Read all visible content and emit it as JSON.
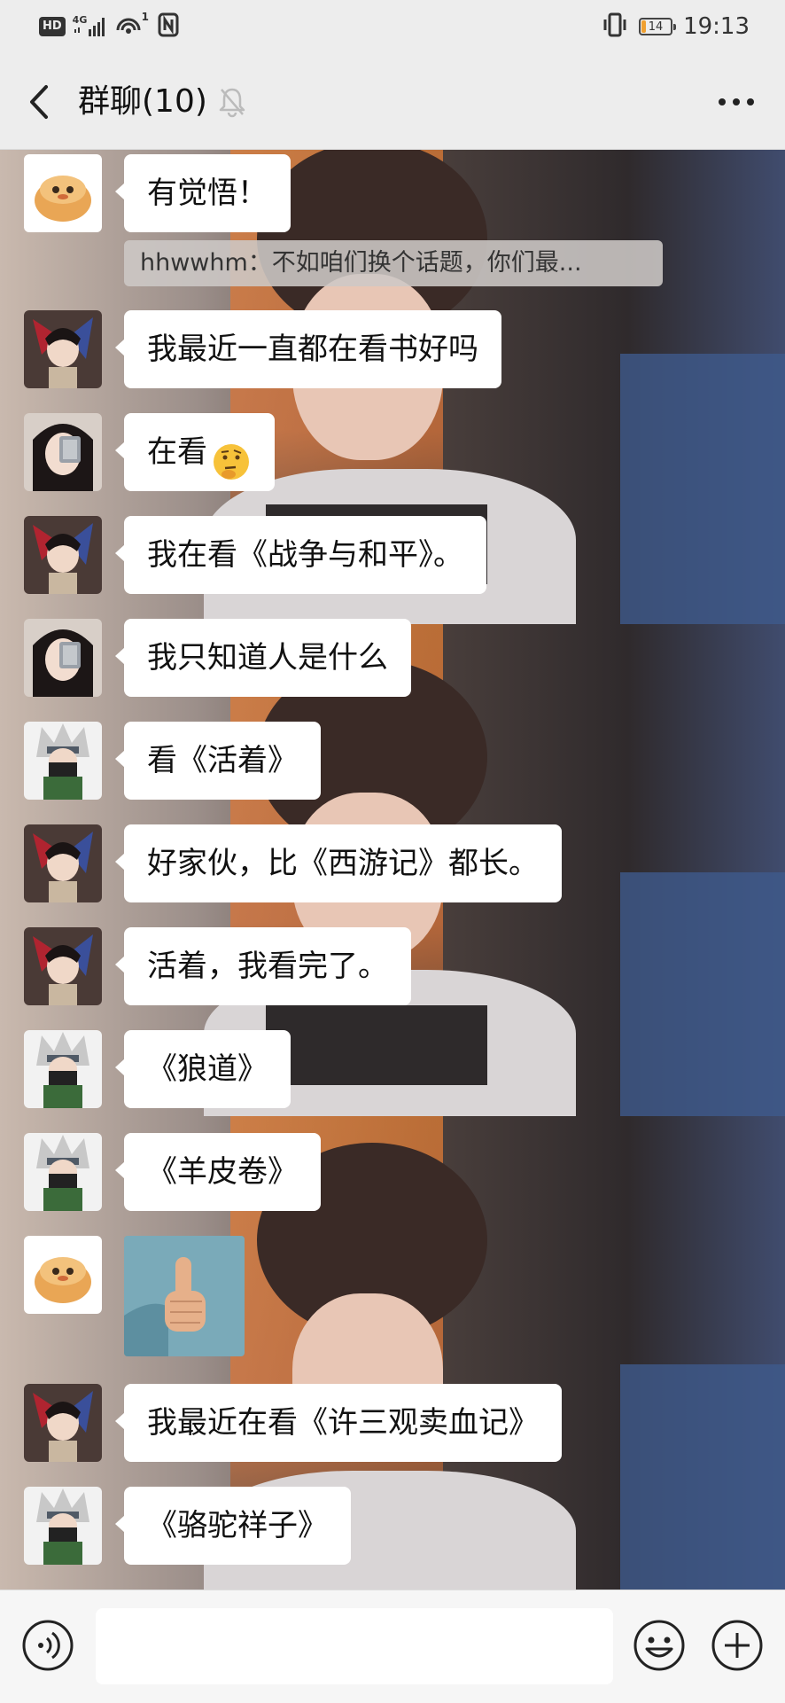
{
  "status_bar": {
    "hd": "HD",
    "network": "4G",
    "signal_superscript": "1",
    "battery_level": "14",
    "battery_fraction": 0.14,
    "time": "19:13",
    "icons": [
      "hd-icon",
      "signal-icon",
      "wifi-hotspot-icon",
      "nfc-icon",
      "vibrate-icon",
      "battery-icon"
    ]
  },
  "header": {
    "title": "群聊(10)",
    "icons": [
      "back-arrow-icon",
      "mute-bell-icon",
      "more-dots-icon"
    ]
  },
  "quoted_message": {
    "text": "hhwwhm：不如咱们换个话题，你们最..."
  },
  "messages": [
    {
      "avatar": "cream-puff-avatar",
      "text": "有觉悟！"
    },
    {
      "avatar": "anime-boy-avatar",
      "text": "我最近一直都在看书好吗"
    },
    {
      "avatar": "girl-selfie-avatar",
      "text": "在看",
      "emoji": "thinking-face-emoji"
    },
    {
      "avatar": "anime-boy-avatar",
      "text": "我在看《战争与和平》。"
    },
    {
      "avatar": "girl-selfie-avatar",
      "text": "我只知道人是什么"
    },
    {
      "avatar": "kakashi-avatar",
      "text": "看《活着》"
    },
    {
      "avatar": "anime-boy-avatar",
      "text": "好家伙，比《西游记》都长。"
    },
    {
      "avatar": "anime-boy-avatar",
      "text": "活着，我看完了。"
    },
    {
      "avatar": "kakashi-avatar",
      "text": "《狼道》"
    },
    {
      "avatar": "kakashi-avatar",
      "text": "《羊皮卷》"
    },
    {
      "avatar": "cream-puff-avatar",
      "sticker": "thumbs-up-sticker"
    },
    {
      "avatar": "anime-boy-avatar",
      "text": "我最近在看《许三观卖血记》"
    },
    {
      "avatar": "kakashi-avatar",
      "text": "《骆驼祥子》"
    }
  ],
  "input_bar": {
    "placeholder": "",
    "icons": [
      "voice-icon",
      "emoji-icon",
      "plus-icon"
    ]
  },
  "colors": {
    "bubble": "#ffffff",
    "page_bg": "#ededed",
    "chat_bg": "#6b5c55",
    "orange_accent": "#e8872a"
  }
}
